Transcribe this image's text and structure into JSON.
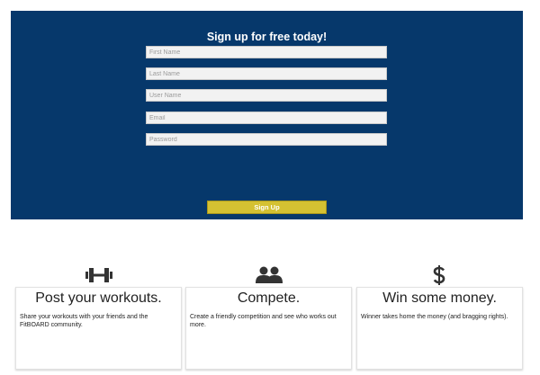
{
  "colors": {
    "hero_bg": "#06386b",
    "button_bg": "#d4c132",
    "icon": "#333333"
  },
  "signup": {
    "title": "Sign up for free today!",
    "fields": [
      {
        "placeholder": "First Name",
        "value": ""
      },
      {
        "placeholder": "Last Name",
        "value": ""
      },
      {
        "placeholder": "User Name",
        "value": ""
      },
      {
        "placeholder": "Email",
        "value": ""
      },
      {
        "placeholder": "Password",
        "value": ""
      }
    ],
    "button_label": "Sign Up"
  },
  "features": [
    {
      "icon": "dumbbell-icon",
      "title": "Post your workouts.",
      "text": "Share your workouts with your friends and the FitBOARD community."
    },
    {
      "icon": "users-icon",
      "title": "Compete.",
      "text": "Create a friendly competition and see who works out more."
    },
    {
      "icon": "dollar-icon",
      "title": "Win some money.",
      "text": "Winner takes home the money (and bragging rights)."
    }
  ]
}
